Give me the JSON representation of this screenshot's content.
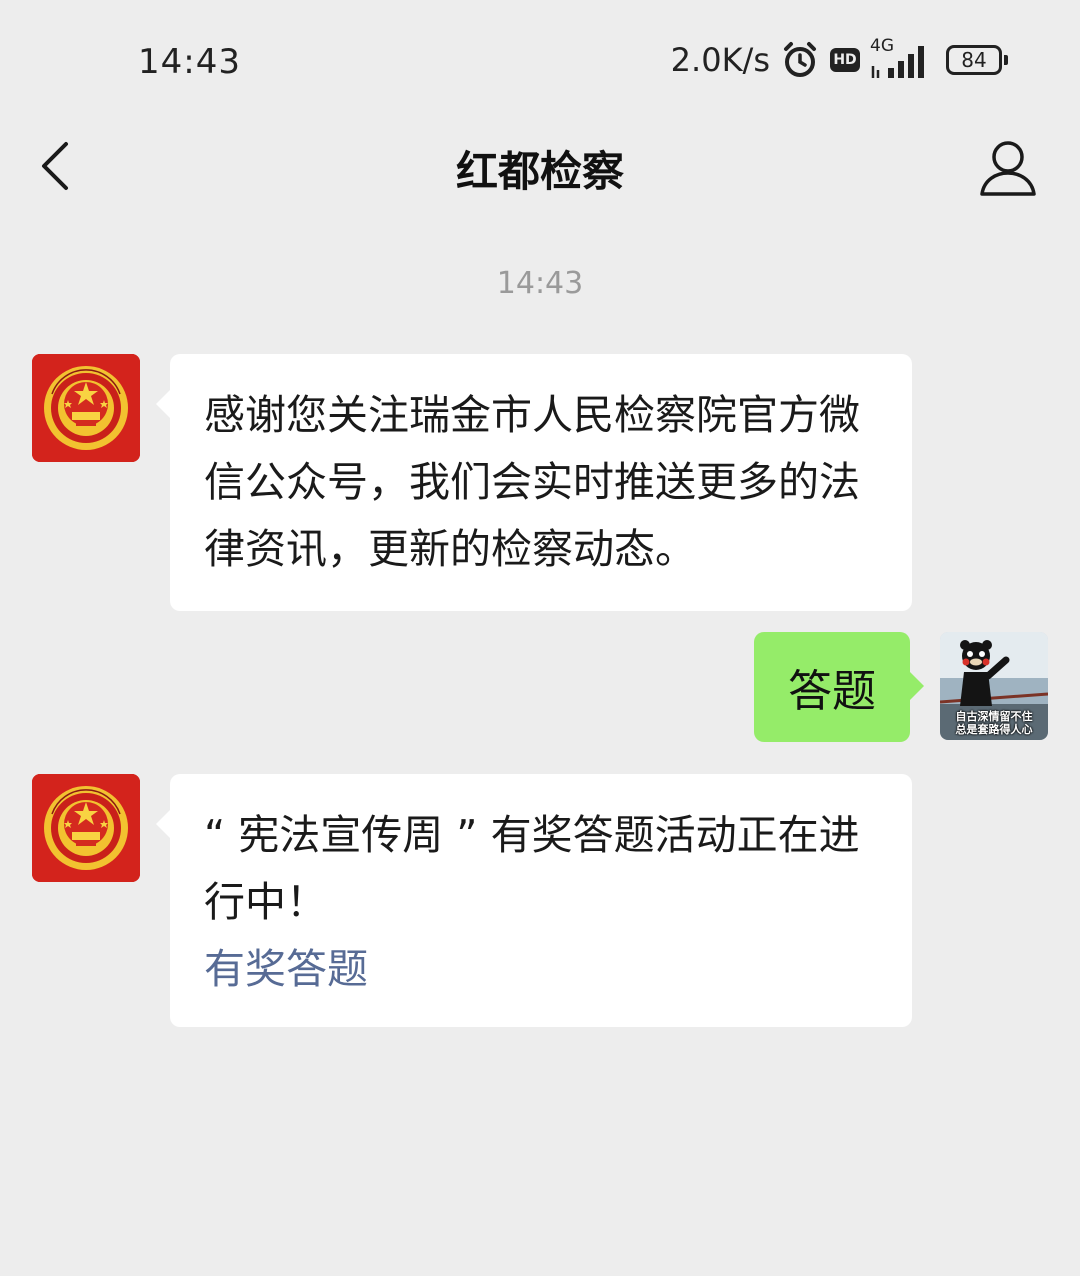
{
  "status_bar": {
    "time": "14:43",
    "net_speed": "2.0K/s",
    "hd_label": "HD",
    "network_type": "4G",
    "battery": "84",
    "icons": [
      "alarm-icon",
      "hd-icon",
      "signal-icon",
      "battery-icon"
    ]
  },
  "nav": {
    "title": "红都检察",
    "back_icon": "chevron-left-icon",
    "profile_icon": "person-icon"
  },
  "chat": {
    "timestamp": "14:43",
    "messages": [
      {
        "from": "official",
        "avatar_icon": "procuratorate-emblem-icon",
        "text": "感谢您关注瑞金市人民检察院官方微信公众号，我们会实时推送更多的法律资讯，更新的检察动态。"
      },
      {
        "from": "user",
        "text": "答题",
        "avatar_caption_line1": "自古深情留不住",
        "avatar_caption_line2": "总是套路得人心"
      },
      {
        "from": "official",
        "avatar_icon": "procuratorate-emblem-icon",
        "text": "“ 宪法宣传周 ” 有奖答题活动正在进行中！",
        "link_text": "有奖答题"
      }
    ]
  },
  "colors": {
    "background": "#ededed",
    "incoming_bubble": "#ffffff",
    "outgoing_bubble": "#95ec69",
    "link": "#576b95",
    "emblem_red": "#d3231c"
  }
}
